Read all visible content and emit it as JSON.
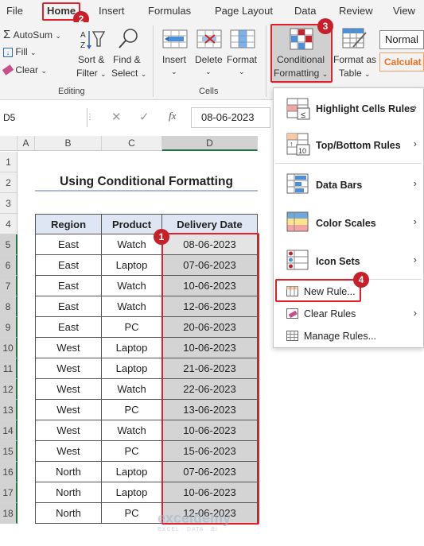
{
  "tabs": [
    "File",
    "Home",
    "Insert",
    "Formulas",
    "Page Layout",
    "Data",
    "Review",
    "View"
  ],
  "ribbon": {
    "editing": {
      "autosum": "AutoSum",
      "fill": "Fill",
      "clear": "Clear",
      "sort_filter_1": "Sort &",
      "sort_filter_2": "Filter",
      "find_select_1": "Find &",
      "find_select_2": "Select",
      "group_label": "Editing"
    },
    "cells": {
      "insert": "Insert",
      "delete": "Delete",
      "format": "Format",
      "group_label": "Cells"
    },
    "styles": {
      "cond_fmt_1": "Conditional",
      "cond_fmt_2": "Formatting",
      "format_table_1": "Format as",
      "format_table_2": "Table",
      "style_normal": "Normal",
      "style_calc": "Calculat"
    }
  },
  "formula_bar": {
    "name_box": "D5",
    "value": "08-06-2023",
    "fx": "fx"
  },
  "columns": [
    "A",
    "B",
    "C",
    "D"
  ],
  "rows": [
    "1",
    "2",
    "3",
    "4",
    "5",
    "6",
    "7",
    "8",
    "9",
    "10",
    "11",
    "12",
    "13",
    "14",
    "15",
    "16",
    "17",
    "18"
  ],
  "sheet": {
    "title": "Using Conditional Formatting",
    "headers": [
      "Region",
      "Product",
      "Delivery Date"
    ],
    "data": [
      [
        "East",
        "Watch",
        "08-06-2023"
      ],
      [
        "East",
        "Laptop",
        "07-06-2023"
      ],
      [
        "East",
        "Watch",
        "10-06-2023"
      ],
      [
        "East",
        "Watch",
        "12-06-2023"
      ],
      [
        "East",
        "PC",
        "20-06-2023"
      ],
      [
        "West",
        "Laptop",
        "10-06-2023"
      ],
      [
        "West",
        "Laptop",
        "21-06-2023"
      ],
      [
        "West",
        "Watch",
        "22-06-2023"
      ],
      [
        "West",
        "PC",
        "13-06-2023"
      ],
      [
        "West",
        "Watch",
        "10-06-2023"
      ],
      [
        "West",
        "PC",
        "15-06-2023"
      ],
      [
        "North",
        "Laptop",
        "07-06-2023"
      ],
      [
        "North",
        "Laptop",
        "10-06-2023"
      ],
      [
        "North",
        "PC",
        "12-06-2023"
      ]
    ]
  },
  "menu": {
    "items": [
      "Highlight Cells Rules",
      "Top/Bottom Rules",
      "Data Bars",
      "Color Scales",
      "Icon Sets",
      "New Rule...",
      "Clear Rules",
      "Manage Rules..."
    ]
  },
  "badges": [
    "1",
    "2",
    "3",
    "4"
  ],
  "watermark": "exceldemy",
  "watermark_sub": "EXCEL · DATA · BI",
  "colors": {
    "accent_red": "#e0202a",
    "badge": "#c8202a",
    "header_fill": "#dde6f2",
    "date_fill": "#d4d4d4"
  }
}
